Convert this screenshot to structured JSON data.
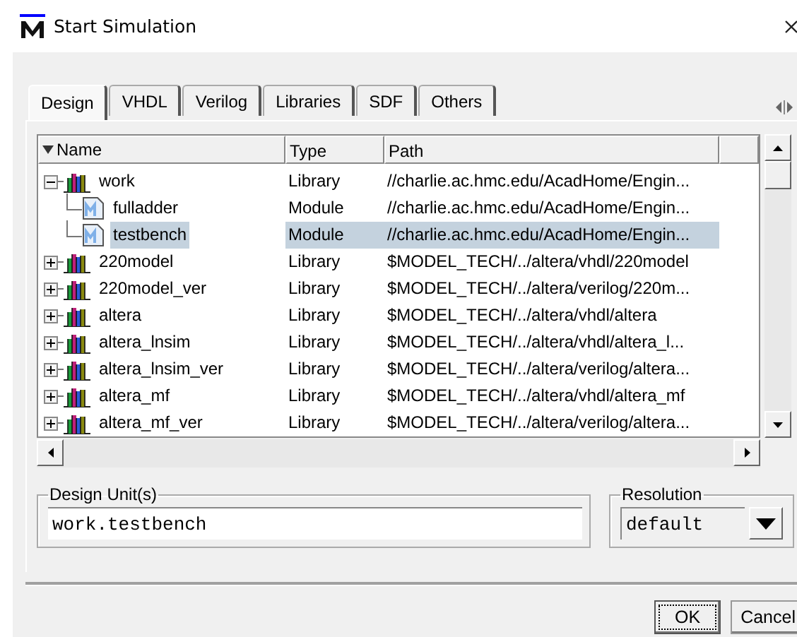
{
  "window": {
    "title": "Start Simulation"
  },
  "tabs": [
    {
      "label": "Design",
      "selected": true
    },
    {
      "label": "VHDL",
      "selected": false
    },
    {
      "label": "Verilog",
      "selected": false
    },
    {
      "label": "Libraries",
      "selected": false
    },
    {
      "label": "SDF",
      "selected": false
    },
    {
      "label": "Others",
      "selected": false
    }
  ],
  "table": {
    "columns": [
      "Name",
      "Type",
      "Path"
    ],
    "rows": [
      {
        "kind": "library",
        "name": "work",
        "type": "Library",
        "path": "//charlie.ac.hmc.edu/AcadHome/Engin...",
        "expanded": true,
        "selected": false,
        "children": [
          {
            "kind": "module",
            "name": "fulladder",
            "type": "Module",
            "path": "//charlie.ac.hmc.edu/AcadHome/Engin...",
            "selected": false
          },
          {
            "kind": "module",
            "name": "testbench",
            "type": "Module",
            "path": "//charlie.ac.hmc.edu/AcadHome/Engin...",
            "selected": true
          }
        ]
      },
      {
        "kind": "library",
        "name": "220model",
        "type": "Library",
        "path": "$MODEL_TECH/../altera/vhdl/220model",
        "expanded": false,
        "selected": false
      },
      {
        "kind": "library",
        "name": "220model_ver",
        "type": "Library",
        "path": "$MODEL_TECH/../altera/verilog/220m...",
        "expanded": false,
        "selected": false
      },
      {
        "kind": "library",
        "name": "altera",
        "type": "Library",
        "path": "$MODEL_TECH/../altera/vhdl/altera",
        "expanded": false,
        "selected": false
      },
      {
        "kind": "library",
        "name": "altera_lnsim",
        "type": "Library",
        "path": "$MODEL_TECH/../altera/vhdl/altera_l...",
        "expanded": false,
        "selected": false
      },
      {
        "kind": "library",
        "name": "altera_lnsim_ver",
        "type": "Library",
        "path": "$MODEL_TECH/../altera/verilog/altera...",
        "expanded": false,
        "selected": false
      },
      {
        "kind": "library",
        "name": "altera_mf",
        "type": "Library",
        "path": "$MODEL_TECH/../altera/vhdl/altera_mf",
        "expanded": false,
        "selected": false
      },
      {
        "kind": "library",
        "name": "altera_mf_ver",
        "type": "Library",
        "path": "$MODEL_TECH/../altera/verilog/altera...",
        "expanded": false,
        "selected": false
      }
    ]
  },
  "design_units": {
    "label": "Design Unit(s)",
    "value": "work.testbench"
  },
  "resolution": {
    "label": "Resolution",
    "value": "default"
  },
  "buttons": [
    {
      "label": "OK",
      "focused": true
    },
    {
      "label": "Cancel",
      "focused": false
    }
  ]
}
